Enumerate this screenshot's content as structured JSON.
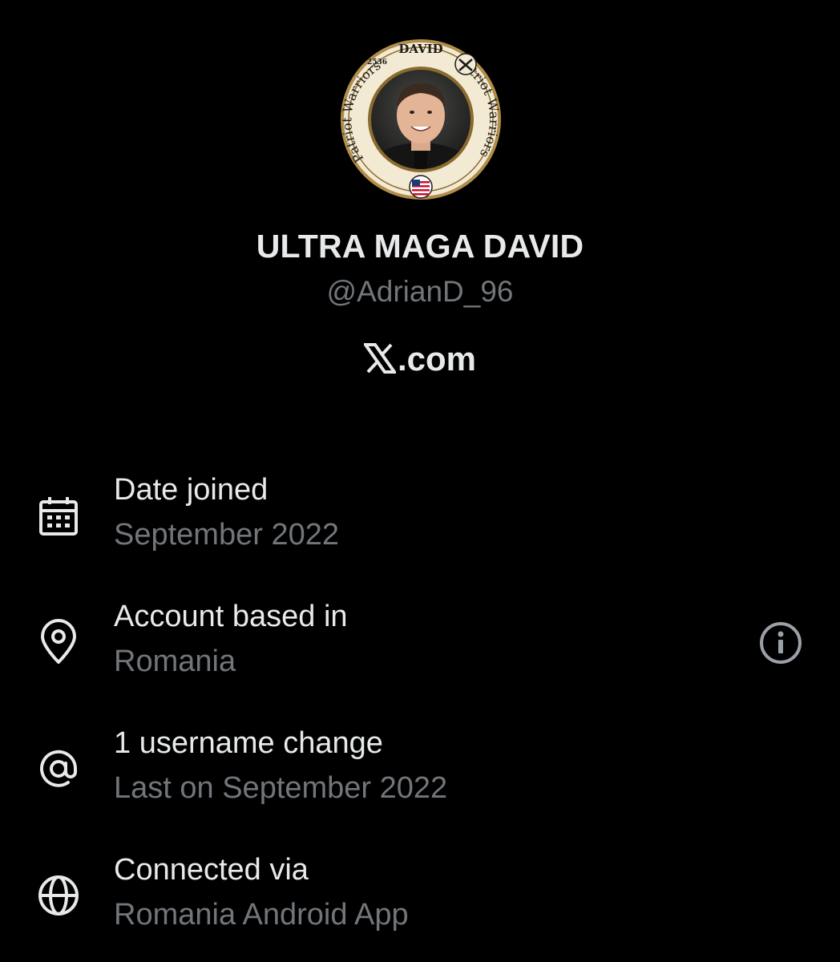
{
  "profile": {
    "avatar": {
      "frame_top_text": "DAVID",
      "frame_number": "2536",
      "frame_ring_text_left": "Patriot Warriors",
      "frame_ring_text_right": "Patriot Warriors",
      "frame_color": "#b08d4a"
    },
    "display_name": "ULTRA MAGA DAVID",
    "handle": "@AdrianD_96",
    "platform": ".com",
    "platform_logo": "x-logo-icon"
  },
  "about": [
    {
      "icon": "calendar-icon",
      "title": "Date joined",
      "value": "September 2022"
    },
    {
      "icon": "location-pin-icon",
      "title": "Account based in",
      "value": "Romania",
      "action_icon": "info-icon"
    },
    {
      "icon": "at-sign-icon",
      "title": "1 username change",
      "value": "Last on September 2022"
    },
    {
      "icon": "globe-icon",
      "title": "Connected via",
      "value": "Romania Android App"
    }
  ],
  "colors": {
    "background": "#000000",
    "primary_text": "#e7e9ea",
    "secondary_text": "#71767b"
  }
}
